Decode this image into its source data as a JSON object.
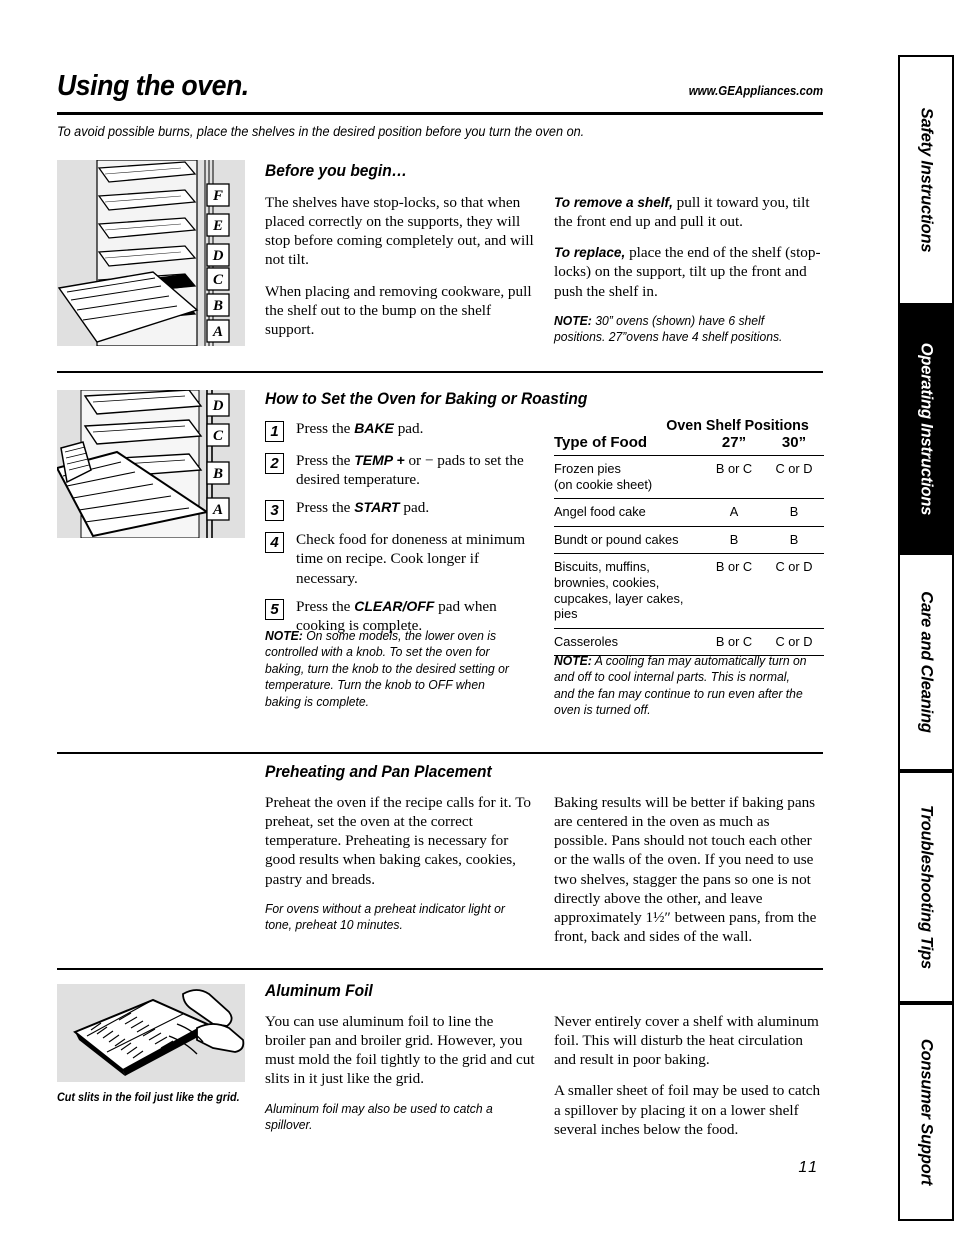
{
  "header": {
    "title": "Using the oven.",
    "website": "www.GEAppliances.com",
    "intro": "To avoid possible burns, place the shelves in the desired position before you turn the oven on."
  },
  "page_number": "11",
  "sidebar": {
    "tabs": [
      {
        "label": "Safety Instructions",
        "active": false
      },
      {
        "label": "Operating Instructions",
        "active": true
      },
      {
        "label": "Care and Cleaning",
        "active": false
      },
      {
        "label": "Troubleshooting Tips",
        "active": false
      },
      {
        "label": "Consumer Support",
        "active": false
      }
    ]
  },
  "sections": {
    "before_you_begin": {
      "heading": "Before you begin…",
      "figure_shelf_labels": [
        "F",
        "E",
        "D",
        "C",
        "B",
        "A"
      ],
      "left_paragraphs": [
        "The shelves have stop-locks, so that when placed correctly on the supports, they will stop before coming completely out, and will not tilt.",
        "When placing and removing cookware, pull the shelf out to the bump on the shelf support."
      ],
      "right_items": [
        {
          "lead": "To remove a shelf,",
          "text": " pull it toward you, tilt the front end up and pull it out."
        },
        {
          "lead": "To replace,",
          "text": " place the end of the shelf (stop-locks) on the support, tilt up the front and push the shelf in."
        }
      ],
      "note_lead": "NOTE:",
      "note_text": " 30” ovens (shown) have 6 shelf positions. 27”ovens have 4 shelf positions."
    },
    "baking": {
      "heading": "How to Set the Oven for Baking or Roasting",
      "figure_shelf_labels": [
        "D",
        "C",
        "B",
        "A"
      ],
      "steps": [
        {
          "num": "1",
          "before": "Press the ",
          "kbd": "BAKE",
          "after": " pad."
        },
        {
          "num": "2",
          "before": "Press the ",
          "kbd": "TEMP +",
          "after": " or − pads to set the desired temperature."
        },
        {
          "num": "3",
          "before": "Press the ",
          "kbd": "START",
          "after": " pad."
        },
        {
          "num": "4",
          "before": "Check food for doneness at minimum time on recipe. Cook longer if necessary.",
          "kbd": "",
          "after": ""
        },
        {
          "num": "5",
          "before": "Press the ",
          "kbd": "CLEAR/OFF",
          "after": " pad when cooking is complete."
        }
      ],
      "note_lead": "NOTE:",
      "note_text": " On some models, the lower oven is controlled with a knob. To set the oven for baking, turn the knob to the desired setting or temperature. Turn the knob to OFF when baking is complete.",
      "table": {
        "title": "Oven Shelf Positions",
        "columns": [
          "Type of Food",
          "27”",
          "30”"
        ],
        "rows": [
          {
            "food": "Frozen pies",
            "food_sub": "(on cookie sheet)",
            "c27": "B or C",
            "c30": "C or D"
          },
          {
            "food": "Angel food cake",
            "food_sub": "",
            "c27": "A",
            "c30": "B"
          },
          {
            "food": "Bundt or pound cakes",
            "food_sub": "",
            "c27": "B",
            "c30": "B"
          },
          {
            "food": "Biscuits, muffins, brownies, cookies, cupcakes, layer cakes, pies",
            "food_sub": "",
            "c27": "B or C",
            "c30": "C or D"
          },
          {
            "food": "Casseroles",
            "food_sub": "",
            "c27": "B or C",
            "c30": "C or D"
          }
        ]
      },
      "table_note_lead": "NOTE:",
      "table_note_text": " A cooling fan may automatically turn on and off to cool internal parts. This is normal, and the fan may continue to run even after the oven is turned off."
    },
    "preheating": {
      "heading": "Preheating and Pan Placement",
      "left_paragraph": "Preheat the oven if the recipe calls for it. To preheat, set the oven at the correct temperature. Preheating is necessary for good results when baking cakes, cookies, pastry and breads.",
      "left_italic": "For ovens without a preheat indicator light or tone, preheat 10 minutes.",
      "right_paragraph": "Baking results will be better if baking pans are centered in the oven as much as possible. Pans should not touch each other or the walls of the oven. If you need to use two shelves, stagger the pans so one is not directly above the other, and leave approximately 1½″ between pans, from the front, back and sides of the wall."
    },
    "aluminum_foil": {
      "heading": "Aluminum Foil",
      "figure_caption": "Cut slits in the foil just like the grid.",
      "left_paragraph": "You can use aluminum foil to line the broiler pan and broiler grid. However, you must mold the foil tightly to the grid and cut slits in it just like the grid.",
      "left_italic": "Aluminum foil may also be used to catch a spillover.",
      "right_paragraphs": [
        "Never entirely cover a shelf with aluminum foil. This will disturb the heat circulation and result in poor baking.",
        "A smaller sheet of foil may be used to catch a spillover by placing it on a lower shelf several inches below the food."
      ]
    }
  }
}
